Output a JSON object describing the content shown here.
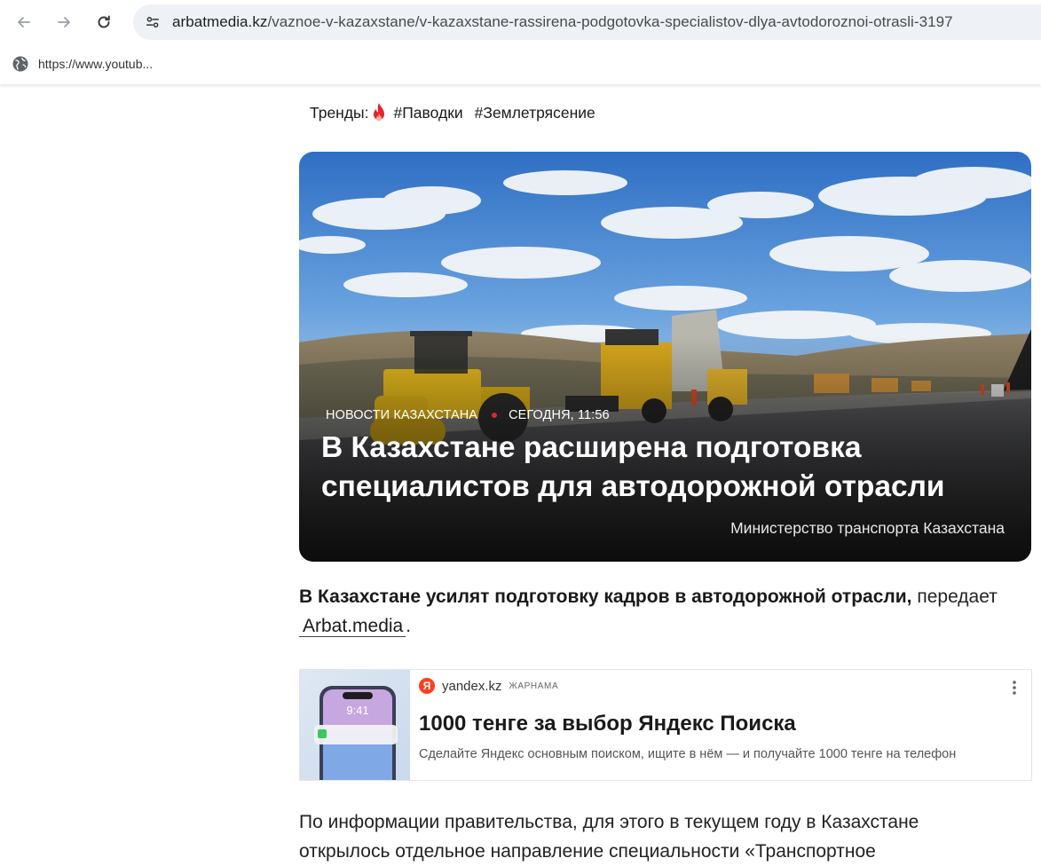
{
  "browser": {
    "url_host": "arbatmedia.kz",
    "url_path": "/vaznoe-v-kazaxstane/v-kazaxstane-rassirena-podgotovka-specialistov-dlya-avtodoroznoi-otrasli-3197",
    "bookmark_label": "https://www.youtub..."
  },
  "trends": {
    "label": "Тренды:",
    "tags": [
      "#Паводки",
      "#Землетрясение"
    ]
  },
  "hero": {
    "category": "НОВОСТИ КАЗАХСТАНА",
    "date": "СЕГОДНЯ, 11:56",
    "title": "В Казахстане расширена подготовка специалистов для автодорожной отрасли",
    "credit": "Министерство транспорта Казахстана"
  },
  "lead": {
    "bold": "В Казахстане усилят подготовку кадров в автодорожной отрасли,",
    "text": " передает ",
    "link": "Arbat.media",
    "end": "."
  },
  "ad": {
    "domain": "yandex.kz",
    "tag": "ЖАРНАМА",
    "logo_letter": "Я",
    "title": "1000 тенге за выбор Яндекс Поиска",
    "description": "Сделайте Яндекс основным поиском, ищите в нём — и получайте 1000 тенге на телефон",
    "phone_time": "9:41"
  },
  "body": {
    "paragraph": "По информации правительства, для этого в текущем году в Казахстане открылось отдельное направление специальности «Транспортное"
  },
  "colors": {
    "accent_red": "#e0262c",
    "yandex_red": "#fc3f1d",
    "address_bar": "#eef1f6"
  }
}
